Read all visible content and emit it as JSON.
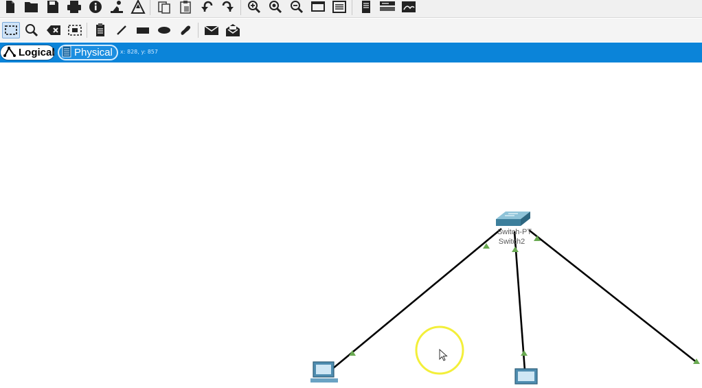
{
  "main_toolbar": {
    "icons": [
      "new-file-icon",
      "open-folder-icon",
      "save-icon",
      "print-icon",
      "info-icon",
      "activity-wizard-icon",
      "custom-device-icon",
      "copy-icon",
      "paste-icon",
      "undo-icon",
      "redo-icon",
      "zoom-in-icon",
      "zoom-reset-icon",
      "zoom-out-icon",
      "drawing-palette-icon",
      "custom-devices-dialog-icon",
      "viewport-icon",
      "network-info-icon",
      "cluster-icon"
    ]
  },
  "draw_toolbar": {
    "icons": [
      "select-icon",
      "inspect-icon",
      "delete-icon",
      "resize-shape-icon",
      "place-note-icon",
      "draw-line-icon",
      "draw-rectangle-icon",
      "draw-ellipse-icon",
      "freeform-icon",
      "add-simple-pdu-icon",
      "add-complex-pdu-icon"
    ]
  },
  "view_bar": {
    "logical_label": "Logical",
    "physical_label": "Physical",
    "coordinates": "x: 828, y: 857",
    "bar_color": "#0b84d9"
  },
  "workspace": {
    "switch": {
      "model_label": "Switch-PT",
      "name_label": "Switch2"
    },
    "link_color": "#000000",
    "link_light_color": "#6aaa52",
    "cursor_highlight_color": "#f3ef3a"
  }
}
